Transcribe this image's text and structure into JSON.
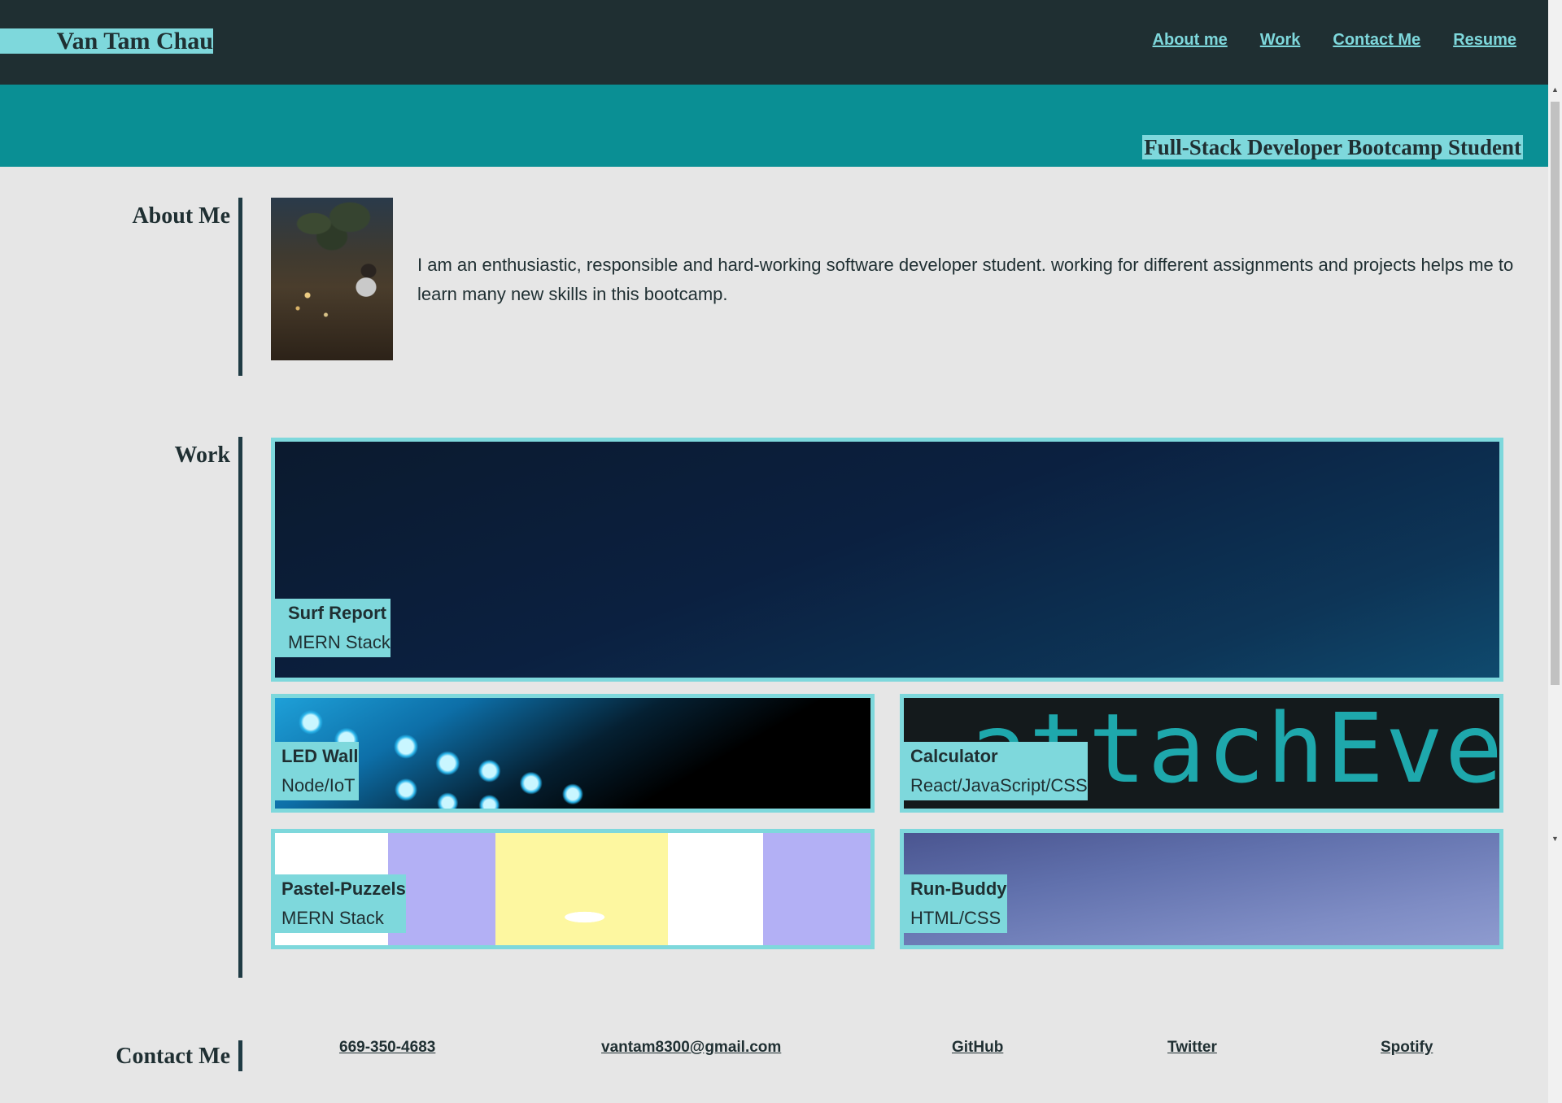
{
  "header": {
    "brand": "Van Tam Chau",
    "nav": [
      "About me",
      "Work",
      "Contact Me",
      "Resume"
    ]
  },
  "hero": {
    "tagline": "Full-Stack Developer Bootcamp Student"
  },
  "about": {
    "title": "About Me",
    "text": "I am an enthusiastic, responsible and hard-working software developer student. working for different assignments and projects helps me to learn many new skills in this bootcamp."
  },
  "work": {
    "title": "Work",
    "projects": [
      {
        "title": "Surf Report",
        "stack": "MERN Stack"
      },
      {
        "title": "LED Wall",
        "stack": "Node/IoT"
      },
      {
        "title": "Calculator",
        "stack": "React/JavaScript/CSS",
        "image_text": "attachEve"
      },
      {
        "title": "Pastel-Puzzels",
        "stack": "MERN Stack"
      },
      {
        "title": "Run-Buddy",
        "stack": "HTML/CSS"
      }
    ]
  },
  "contact": {
    "title": "Contact Me",
    "links": [
      "669-350-4683",
      "vantam8300@gmail.com",
      "GitHub",
      "Twitter",
      "Spotify"
    ]
  },
  "colors": {
    "header_bg": "#1f2f32",
    "hero_bg": "#0a8f94",
    "accent": "#7ed8dc",
    "page_bg": "#e6e6e6",
    "text": "#1f2f32"
  },
  "icons": {
    "scroll_up": "▲",
    "scroll_down": "▼"
  }
}
